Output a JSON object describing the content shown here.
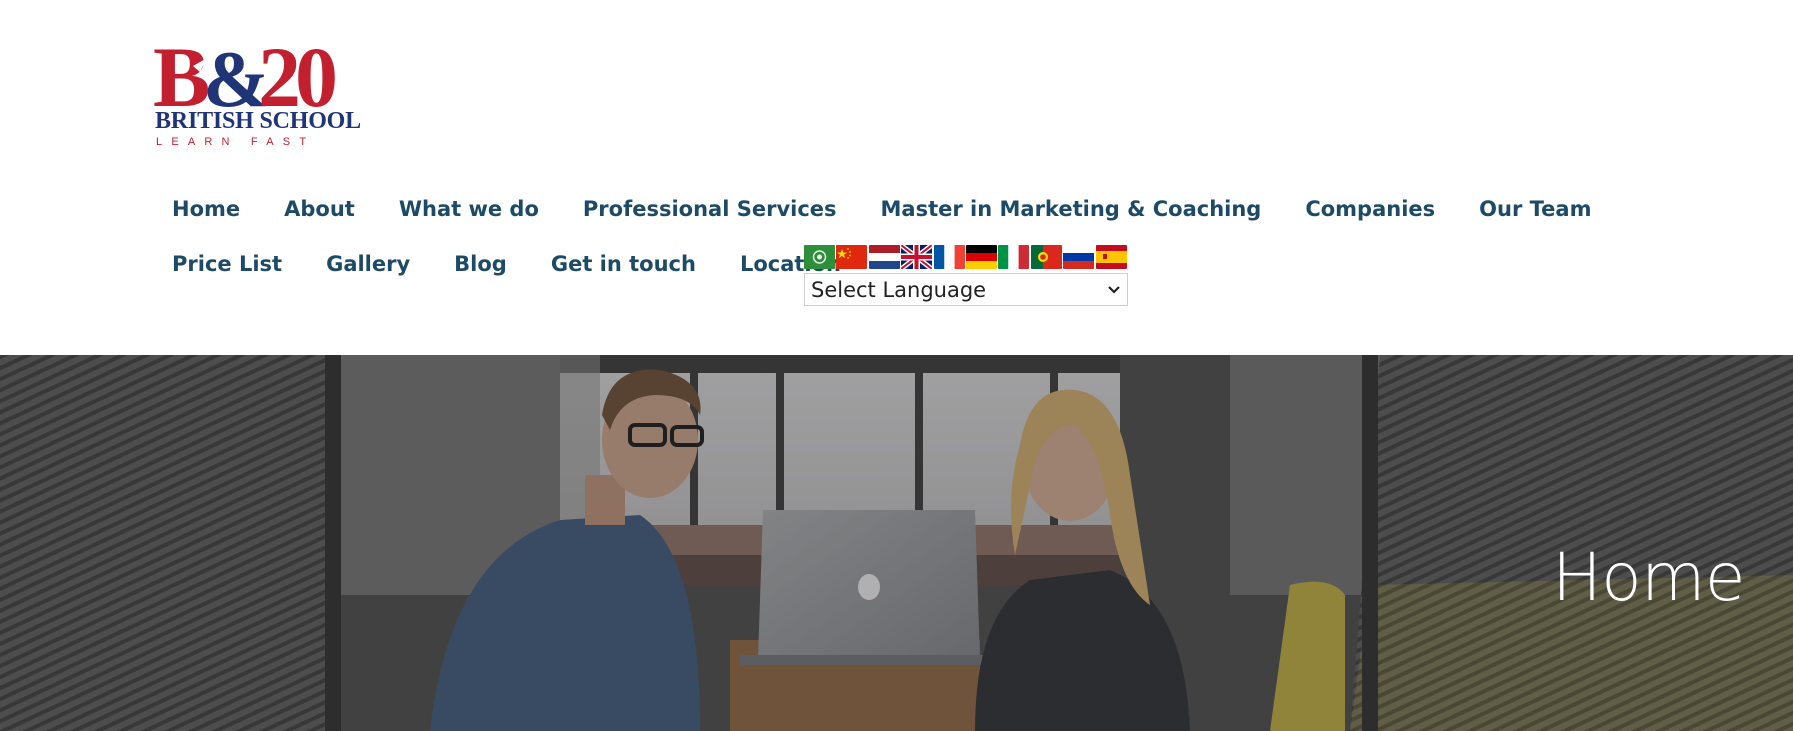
{
  "logo": {
    "mark_text": "BS20",
    "school_text": "BRITISH SCHOOL",
    "tagline": "LEARN FAST",
    "colors": {
      "red": "#c3202f",
      "blue": "#1f3578"
    }
  },
  "nav": {
    "row1": [
      "Home",
      "About",
      "What we do",
      "Professional Services",
      "Master in Marketing & Coaching",
      "Companies",
      "Our Team"
    ],
    "row2": [
      "Price List",
      "Gallery",
      "Blog",
      "Get in touch",
      "Location"
    ],
    "link_color": "#1d4a66"
  },
  "translator": {
    "flags": [
      "arabic-flag-icon",
      "chinese-flag-icon",
      "dutch-flag-icon",
      "english-flag-icon",
      "french-flag-icon",
      "german-flag-icon",
      "italian-flag-icon",
      "portuguese-flag-icon",
      "russian-flag-icon",
      "spanish-flag-icon"
    ],
    "select_value": "Select Language"
  },
  "hero": {
    "title": "Home",
    "overlay_icon": "photo-office-meeting"
  }
}
